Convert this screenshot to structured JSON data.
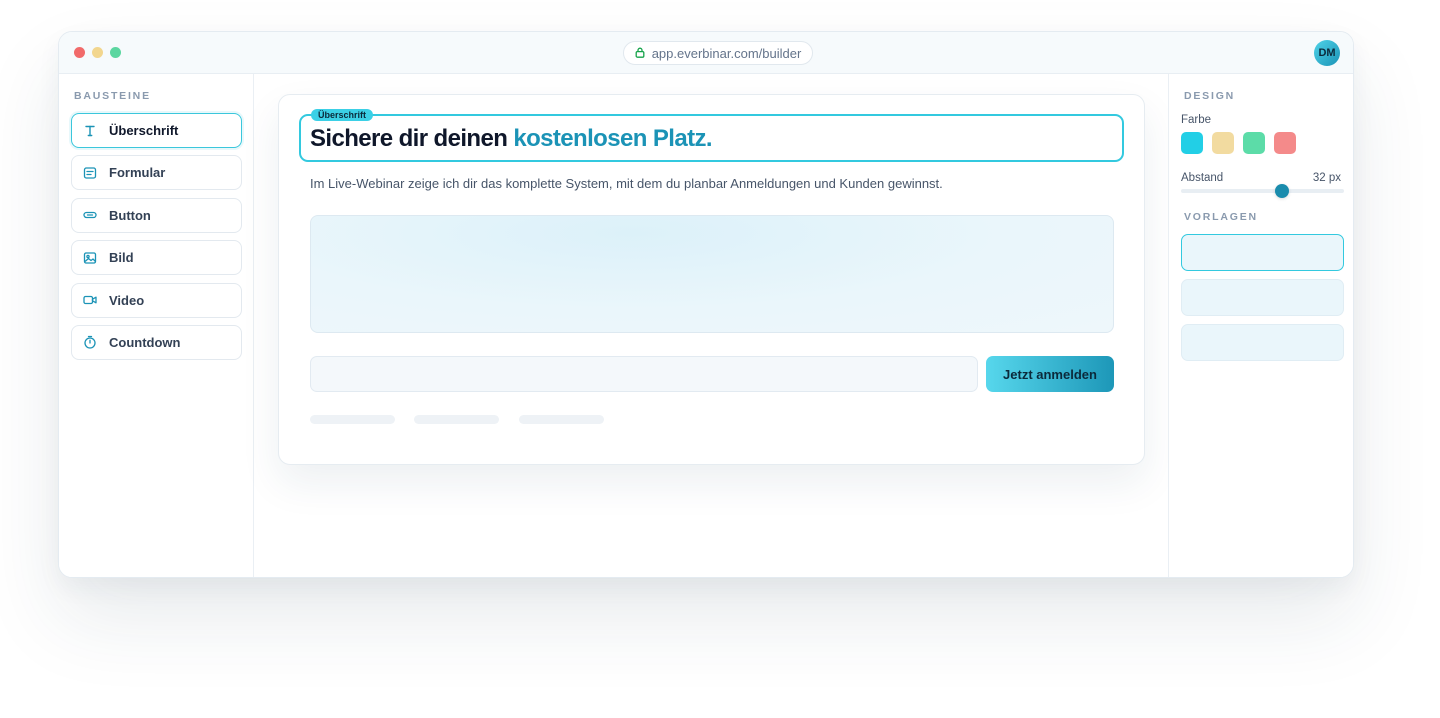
{
  "window": {
    "traffic_lights": {
      "red": "#f16a6a",
      "yellow": "#f2d68e",
      "green": "#5bd6a0"
    },
    "url": "app.everbinar.com/builder",
    "url_icon": "lock-icon",
    "avatar_initials": "DM"
  },
  "sidebar": {
    "title": "BAUSTEINE",
    "items": [
      {
        "label": "Überschrift",
        "icon": "text-icon",
        "active": true
      },
      {
        "label": "Formular",
        "icon": "form-icon",
        "active": false
      },
      {
        "label": "Button",
        "icon": "button-icon",
        "active": false
      },
      {
        "label": "Bild",
        "icon": "image-icon",
        "active": false
      },
      {
        "label": "Video",
        "icon": "video-icon",
        "active": false
      },
      {
        "label": "Countdown",
        "icon": "timer-icon",
        "active": false
      }
    ]
  },
  "canvas": {
    "selected_tag": "Überschrift",
    "headline_main": "Sichere dir deinen ",
    "headline_accent": "kostenlosen Platz.",
    "subtext": "Im Live-Webinar zeige ich dir das komplette System, mit dem du planbar Anmeldungen und Kunden gewinnst.",
    "cta_label": "Jetzt anmelden"
  },
  "design_panel": {
    "title": "DESIGN",
    "color_label": "Farbe",
    "swatches": [
      "#22cfe6",
      "#f2dba0",
      "#5cdca8",
      "#f48a8a"
    ],
    "spacing_label": "Abstand",
    "spacing_value": "32 px",
    "spacing_fraction": 0.62,
    "templates_title": "VORLAGEN",
    "templates_count_selected": 1
  },
  "colors": {
    "accent": "#1b93b6",
    "accent_light": "#33c9df"
  }
}
